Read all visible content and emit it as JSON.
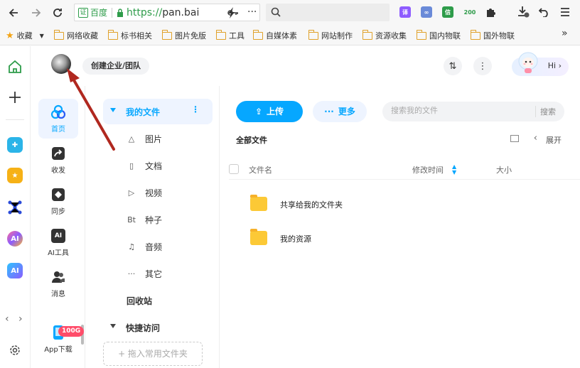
{
  "browser": {
    "address": {
      "cert_label": "证",
      "site_label": "百度",
      "scheme": "https://",
      "host": "pan.bai"
    },
    "extensions": [
      {
        "name": "translate-extension",
        "label": "译",
        "color": "#8e5cff"
      },
      {
        "name": "link-extension",
        "label": "∞",
        "color": "#6a8ad8"
      },
      {
        "name": "green-extension",
        "label": "信",
        "color": "#2e9c4a"
      },
      {
        "name": "counter-extension",
        "label": "200",
        "color": "#2e9c4a"
      }
    ],
    "bookmarks": [
      {
        "label": "收藏"
      },
      {
        "label": "网络收藏"
      },
      {
        "label": "标书相关"
      },
      {
        "label": "图片免版"
      },
      {
        "label": "工具"
      },
      {
        "label": "自媒体素"
      },
      {
        "label": "网站制作"
      },
      {
        "label": "资源收集"
      },
      {
        "label": "国内物联"
      },
      {
        "label": "国外物联"
      }
    ],
    "bookmarks_overflow": "»"
  },
  "header": {
    "team_button": "创建企业/团队",
    "sort_icon": "⇅",
    "more_icon": "⋮",
    "hi_label": "Hi ›"
  },
  "nav": {
    "items": [
      {
        "label": "首页"
      },
      {
        "label": "收发"
      },
      {
        "label": "同步"
      },
      {
        "label": "AI工具"
      },
      {
        "label": "消息"
      }
    ],
    "app_download": "App下载",
    "app_badge": "100G"
  },
  "tree": {
    "my_files": "我的文件",
    "my_files_more": "⋮",
    "items": [
      {
        "icon": "△",
        "label": "图片"
      },
      {
        "icon": "▯",
        "label": "文档"
      },
      {
        "icon": "▷",
        "label": "视频"
      },
      {
        "icon": "Bt",
        "label": "种子"
      },
      {
        "icon": "♫",
        "label": "音频"
      },
      {
        "icon": "···",
        "label": "其它"
      }
    ],
    "recycle": "回收站",
    "quick_access": "快捷访问",
    "dropzone": "+ 拖入常用文件夹"
  },
  "main": {
    "upload_label": "上传",
    "more_label": "更多",
    "search_placeholder": "搜索我的文件",
    "search_button": "搜索",
    "breadcrumb": "全部文件",
    "expand_label": "展开",
    "columns": {
      "name": "文件名",
      "modified": "修改时间",
      "size": "大小"
    },
    "files": [
      {
        "name": "共享给我的文件夹"
      },
      {
        "name": "我的资源"
      }
    ]
  },
  "colors": {
    "accent": "#06a7ff",
    "annotation_arrow": "#b0281f"
  }
}
